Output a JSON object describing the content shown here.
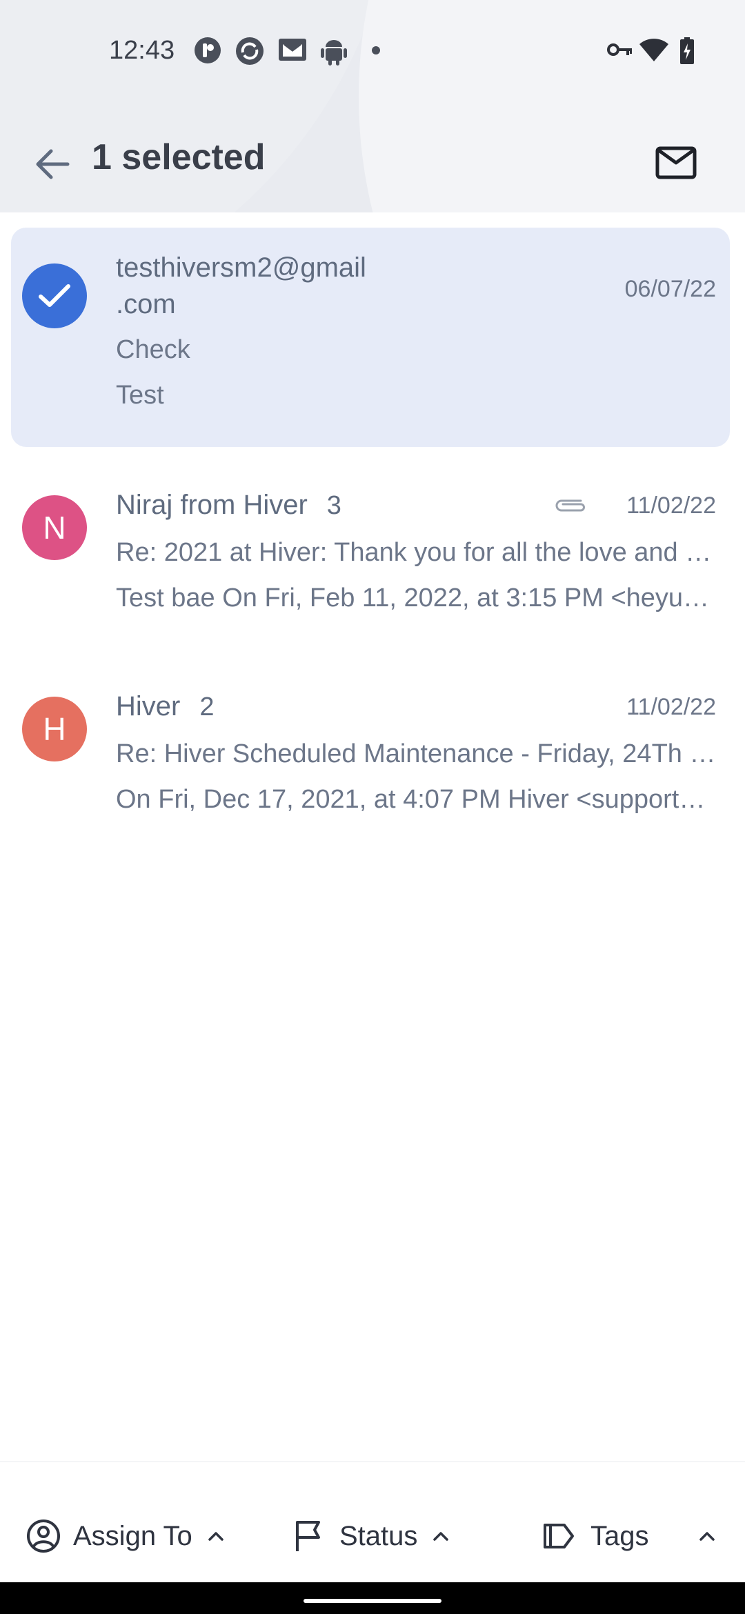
{
  "status_bar": {
    "time": "12:43"
  },
  "app_bar": {
    "title": "1 selected"
  },
  "conversations": [
    {
      "avatar_letter": "",
      "avatar_color": "#3a6fd8",
      "selected": true,
      "sender_line1": "testhiversm2@gmail",
      "sender_line2": ".com",
      "count": "",
      "date": "06/07/22",
      "subject": "Check",
      "preview": "Test"
    },
    {
      "avatar_letter": "N",
      "avatar_color": "#dd5285",
      "selected": false,
      "sender": "Niraj from Hiver",
      "count": "3",
      "has_attachment": true,
      "date": "11/02/22",
      "subject": "Re:  2021 at Hiver: Thank you for all the love and …",
      "preview": "Test bae On Fri, Feb 11, 2022, at 3:15 PM <heyus…"
    },
    {
      "avatar_letter": "H",
      "avatar_color": "#e57060",
      "selected": false,
      "sender": "Hiver",
      "count": "2",
      "date": "11/02/22",
      "subject": "Re: Hiver Scheduled Maintenance - Friday, 24Th …",
      "preview": "On Fri, Dec 17, 2021, at 4:07 PM Hiver <support…"
    }
  ],
  "bottom_actions": {
    "assign_label": "Assign To",
    "status_label": "Status",
    "tags_label": "Tags"
  },
  "icons": [
    "back-arrow-icon",
    "mail-icon",
    "check-icon",
    "paperclip-icon",
    "user-circle-icon",
    "flag-icon",
    "tag-icon",
    "chevron-up-icon"
  ]
}
